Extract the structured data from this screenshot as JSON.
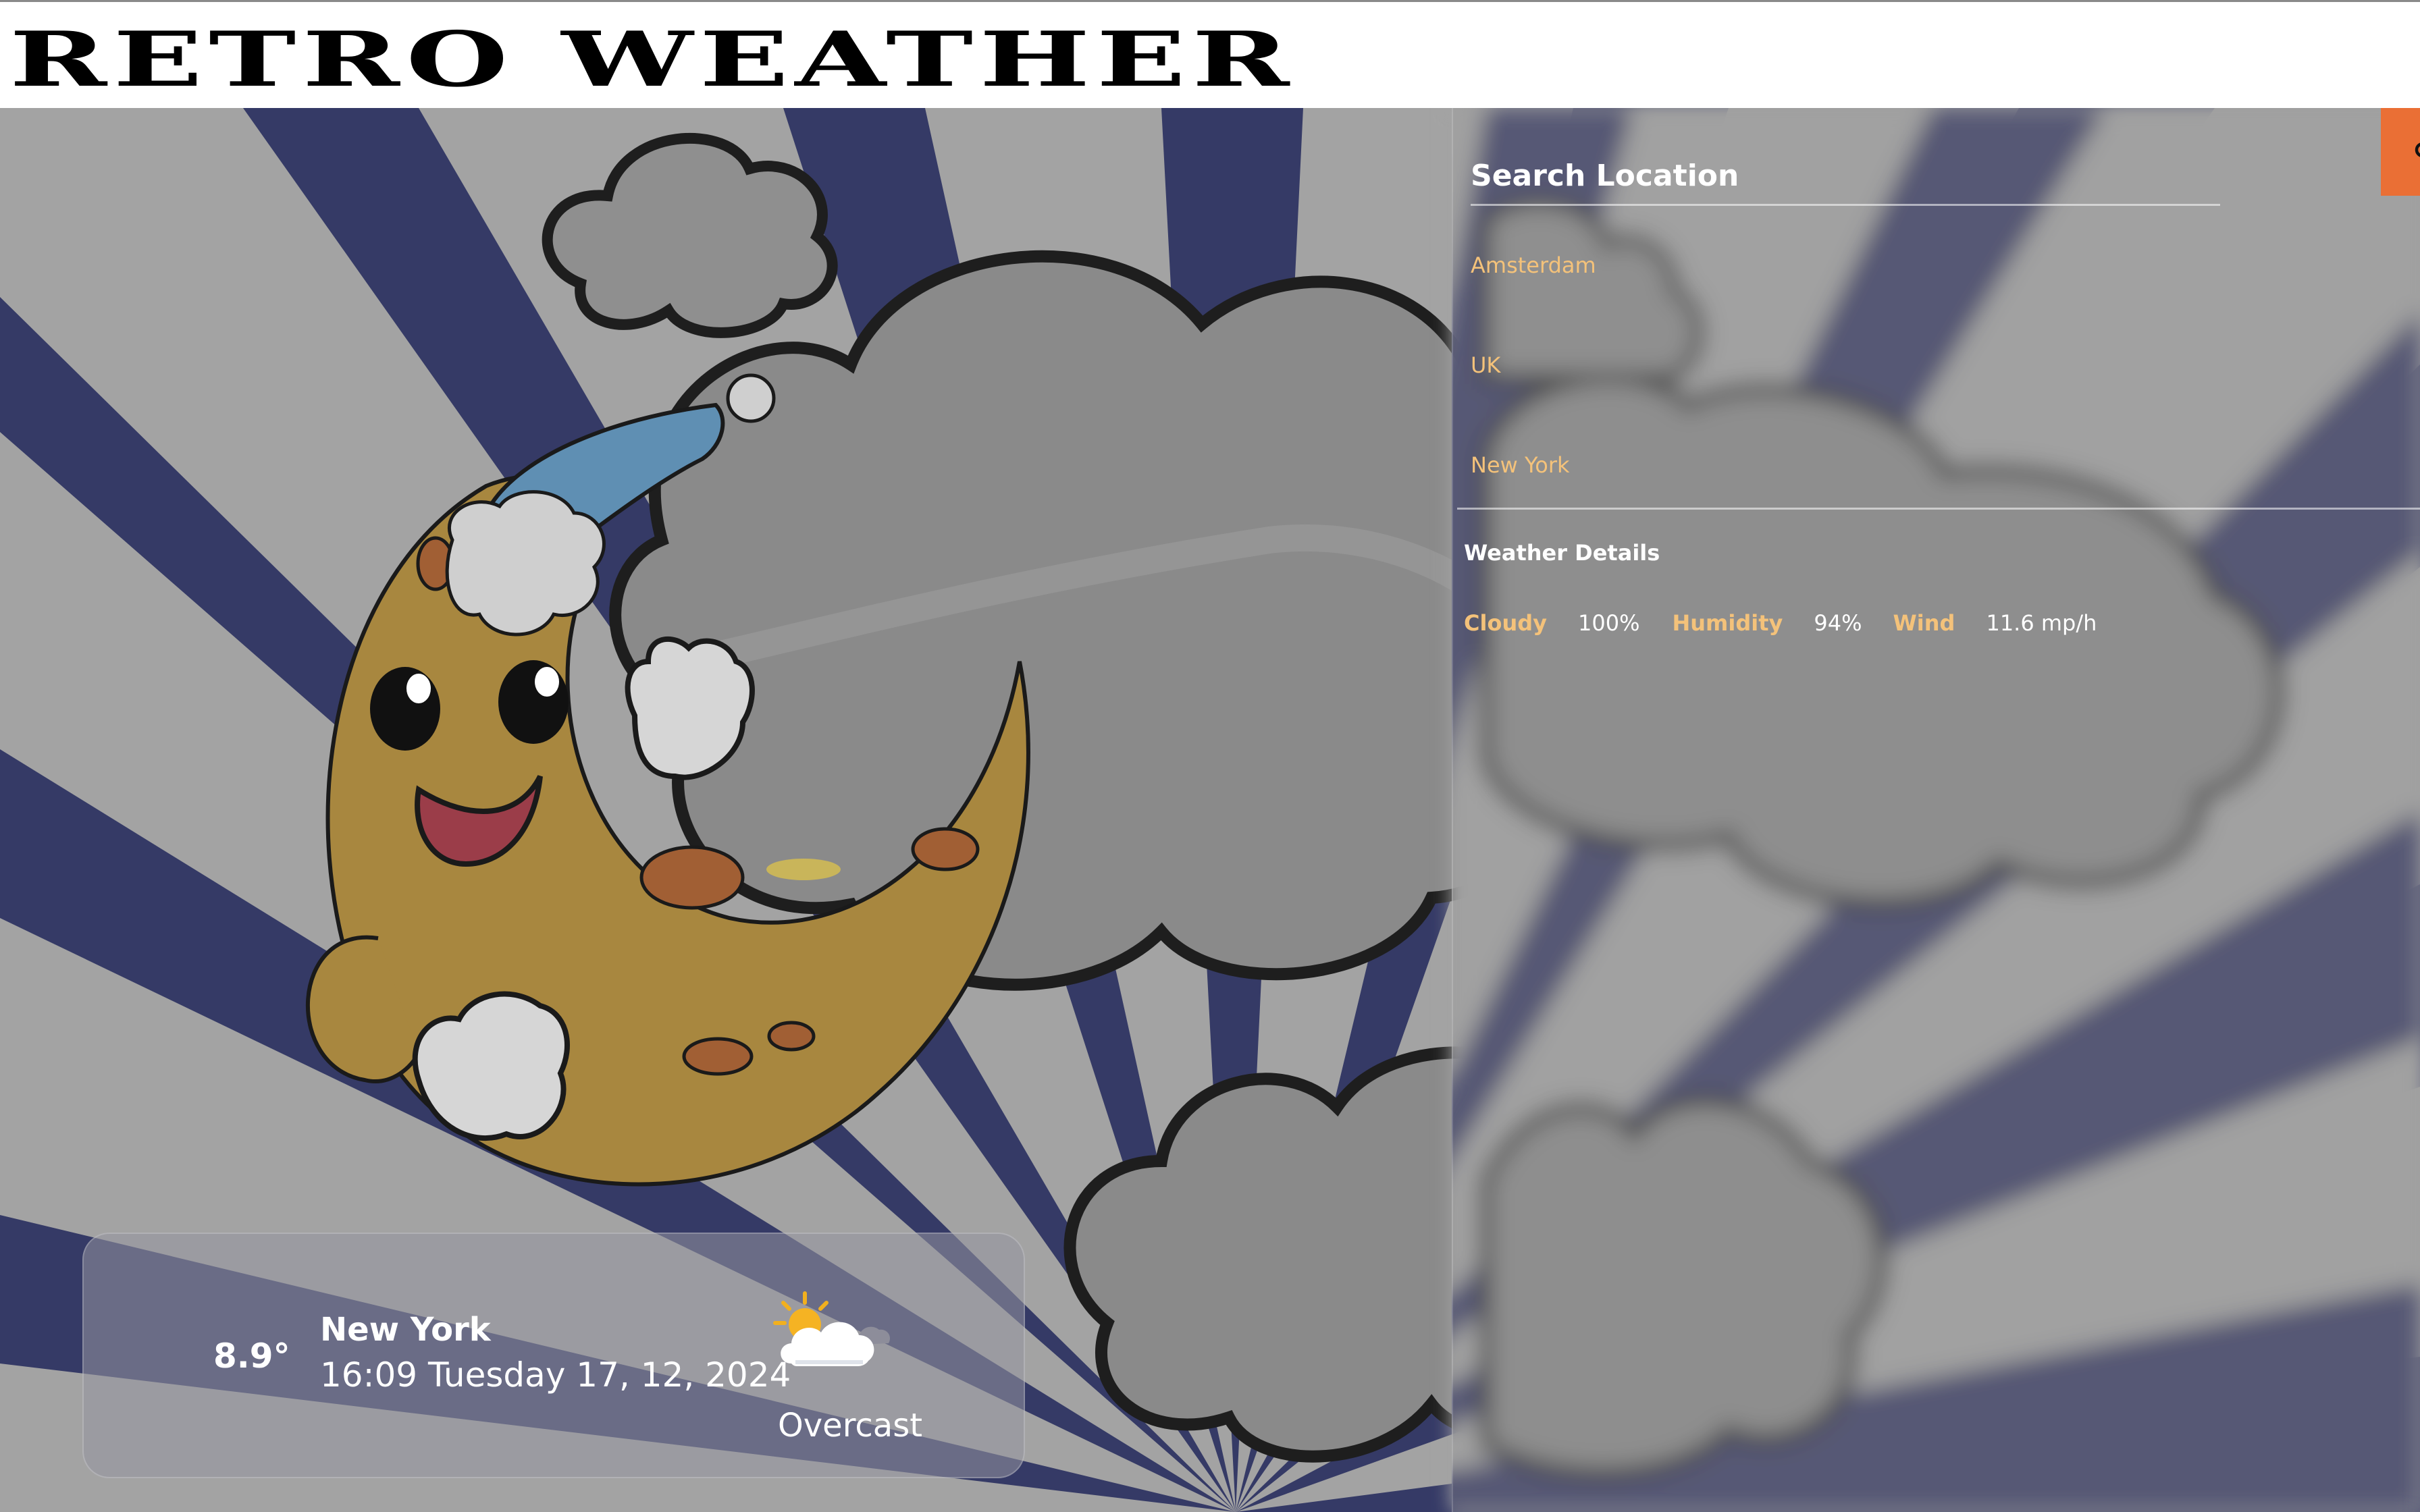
{
  "app": {
    "title": "RETRO WEATHER"
  },
  "search": {
    "placeholder": "Search Location",
    "button_icon": "search-icon",
    "button_color": "#ea6f35"
  },
  "recent_locations": [
    {
      "label": "Amsterdam"
    },
    {
      "label": "UK"
    },
    {
      "label": "New York"
    }
  ],
  "weather_details": {
    "heading": "Weather Details",
    "items": [
      {
        "label": "Cloudy",
        "value": "100%"
      },
      {
        "label": "Humidity",
        "value": "94%"
      },
      {
        "label": "Wind",
        "value": "11.6 mp/h"
      }
    ]
  },
  "current": {
    "temperature": "8.9°",
    "city": "New York",
    "datetime": "16:09 Tuesday 17, 12, 2024",
    "condition": "Overcast",
    "condition_icon": "partly-cloudy-icon"
  },
  "colors": {
    "accent": "#ea6f35",
    "label_gold": "#f4c27a",
    "ray_navy": "#353a66",
    "ray_gray": "#a3a3a3"
  }
}
